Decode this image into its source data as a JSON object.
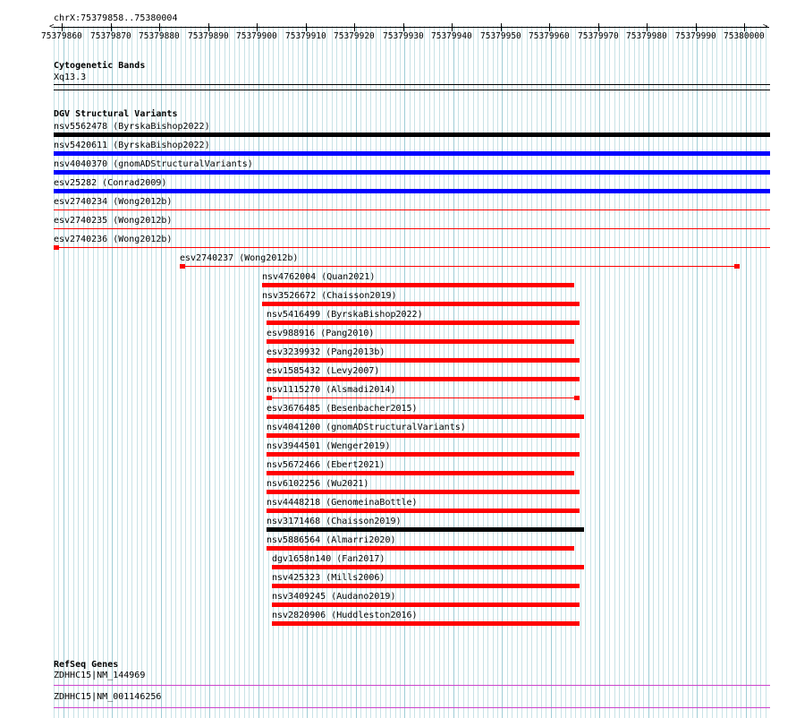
{
  "region_label": "chrX:75379858..75380004",
  "ruler": {
    "tick_labels": [
      "75379860",
      "75379870",
      "75379880",
      "75379890",
      "75379900",
      "75379910",
      "75379920",
      "75379930",
      "75379940",
      "75379950",
      "75379960",
      "75379970",
      "75379980",
      "75379990",
      "75380000"
    ]
  },
  "tracks": {
    "cytobands": {
      "title": "Cytogenetic Bands",
      "band_label": "Xq13.3"
    },
    "dgv": {
      "title": "DGV Structural Variants"
    },
    "refseq": {
      "title": "RefSeq Genes",
      "genes": [
        {
          "label": "ZDHHC15|NM_144969"
        },
        {
          "label": "ZDHHC15|NM_001146256"
        }
      ]
    }
  },
  "colors": {
    "black": "#000000",
    "blue": "#0000ff",
    "red": "#ff0000",
    "magenta": "#cc44cc",
    "grid": "#c8e2e6"
  },
  "features": [
    {
      "label": "nsv5562478 (ByrskaBishop2022)",
      "color": "black",
      "style": "thick"
    },
    {
      "label": "nsv5420611 (ByrskaBishop2022)",
      "color": "blue",
      "style": "thick"
    },
    {
      "label": "nsv4040370 (gnomADStructuralVariants)",
      "color": "blue",
      "style": "thick"
    },
    {
      "label": "esv25282 (Conrad2009)",
      "color": "blue",
      "style": "thick"
    },
    {
      "label": "esv2740234 (Wong2012b)",
      "color": "red",
      "style": "thin"
    },
    {
      "label": "esv2740235 (Wong2012b)",
      "color": "red",
      "style": "thin"
    },
    {
      "label": "esv2740236 (Wong2012b)",
      "color": "red",
      "style": "thin-endcap"
    },
    {
      "label": "esv2740237 (Wong2012b)",
      "color": "red",
      "style": "split"
    },
    {
      "label": "nsv4762004 (Quan2021)",
      "color": "red",
      "style": "thick"
    },
    {
      "label": "nsv3526672 (Chaisson2019)",
      "color": "red",
      "style": "thick"
    },
    {
      "label": "nsv5416499 (ByrskaBishop2022)",
      "color": "red",
      "style": "thick"
    },
    {
      "label": "esv988916 (Pang2010)",
      "color": "red",
      "style": "thick"
    },
    {
      "label": "esv3239932 (Pang2013b)",
      "color": "red",
      "style": "thick"
    },
    {
      "label": "esv1585432 (Levy2007)",
      "color": "red",
      "style": "thick"
    },
    {
      "label": "nsv1115270 (Alsmadi2014)",
      "color": "red",
      "style": "split"
    },
    {
      "label": "esv3676485 (Besenbacher2015)",
      "color": "red",
      "style": "thick"
    },
    {
      "label": "nsv4041200 (gnomADStructuralVariants)",
      "color": "red",
      "style": "thick"
    },
    {
      "label": "nsv3944501 (Wenger2019)",
      "color": "red",
      "style": "thick"
    },
    {
      "label": "nsv5672466 (Ebert2021)",
      "color": "red",
      "style": "thick"
    },
    {
      "label": "nsv6102256 (Wu2021)",
      "color": "red",
      "style": "thick"
    },
    {
      "label": "nsv4448218 (GenomeinaBottle)",
      "color": "red",
      "style": "thick"
    },
    {
      "label": "nsv3171468 (Chaisson2019)",
      "color": "black",
      "style": "thick"
    },
    {
      "label": "nsv5886564 (Almarri2020)",
      "color": "red",
      "style": "thick"
    },
    {
      "label": "dgv1658n140 (Fan2017)",
      "color": "red",
      "style": "thick"
    },
    {
      "label": "nsv425323 (Mills2006)",
      "color": "red",
      "style": "thick"
    },
    {
      "label": "nsv3409245 (Audano2019)",
      "color": "red",
      "style": "thick"
    },
    {
      "label": "nsv2820906 (Huddleston2016)",
      "color": "red",
      "style": "thick"
    }
  ]
}
